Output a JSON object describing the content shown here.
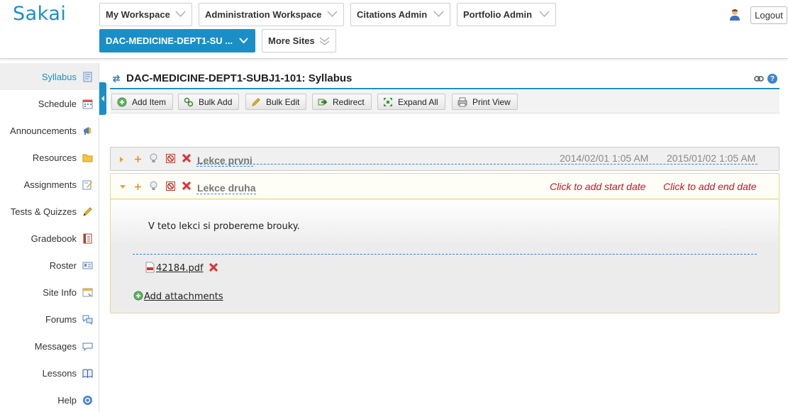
{
  "header": {
    "logo": "Sakai",
    "sites": [
      {
        "label": "My Workspace"
      },
      {
        "label": "Administration Workspace"
      },
      {
        "label": "Citations Admin"
      },
      {
        "label": "Portfolio Admin"
      },
      {
        "label": "DAC-MEDICINE-DEPT1-SU ..."
      },
      {
        "label": "More Sites"
      }
    ],
    "logout_label": "Logout"
  },
  "sidebar": {
    "items": [
      {
        "label": "Syllabus",
        "icon": "syllabus-icon"
      },
      {
        "label": "Schedule",
        "icon": "calendar-icon"
      },
      {
        "label": "Announcements",
        "icon": "megaphone-icon"
      },
      {
        "label": "Resources",
        "icon": "folder-icon"
      },
      {
        "label": "Assignments",
        "icon": "assignment-icon"
      },
      {
        "label": "Tests & Quizzes",
        "icon": "pencil-icon"
      },
      {
        "label": "Gradebook",
        "icon": "gradebook-icon"
      },
      {
        "label": "Roster",
        "icon": "id-card-icon"
      },
      {
        "label": "Site Info",
        "icon": "site-info-icon"
      },
      {
        "label": "Forums",
        "icon": "speech-bubbles-icon"
      },
      {
        "label": "Messages",
        "icon": "message-icon"
      },
      {
        "label": "Lessons",
        "icon": "book-icon"
      },
      {
        "label": "Help",
        "icon": "help-icon"
      }
    ]
  },
  "main": {
    "title": "DAC-MEDICINE-DEPT1-SUBJ1-101: Syllabus",
    "toolbar": {
      "add_item": "Add Item",
      "bulk_add": "Bulk Add",
      "bulk_edit": "Bulk Edit",
      "redirect": "Redirect",
      "expand_all": "Expand All",
      "print_view": "Print View"
    },
    "lessons": [
      {
        "title": "Lekce prvni",
        "start": "2014/02/01 1:05 AM",
        "end": "2015/01/02 1:05 AM"
      },
      {
        "title": "Lekce druha",
        "start": "Click to add start date",
        "end": "Click to add end date",
        "body": "V teto lekci si probereme brouky.",
        "attachment": " 42184.pdf",
        "add_attachments": "Add attachments"
      }
    ]
  },
  "colors": {
    "accent": "#1a8fc7",
    "danger": "#d0102b",
    "link_dash": "#3a7fcf"
  }
}
